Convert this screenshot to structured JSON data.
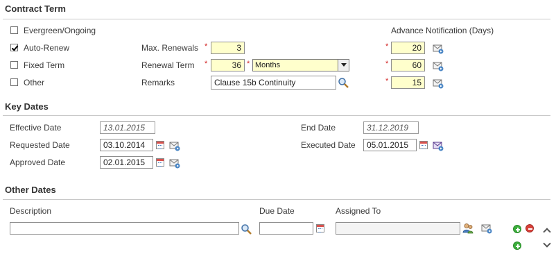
{
  "contract_term": {
    "title": "Contract Term",
    "options": [
      {
        "label": "Evergreen/Ongoing",
        "checked": false
      },
      {
        "label": "Auto-Renew",
        "checked": true
      },
      {
        "label": "Fixed Term",
        "checked": false
      },
      {
        "label": "Other",
        "checked": false
      }
    ],
    "max_renewals": {
      "label": "Max. Renewals",
      "required": "*",
      "value": "3"
    },
    "renewal_term": {
      "label": "Renewal Term",
      "required": "*",
      "value": "36",
      "unit_required": "*",
      "unit": "Months"
    },
    "remarks": {
      "label": "Remarks",
      "value": "Clause 15b Continuity"
    },
    "advance_notification": {
      "label": "Advance Notification (Days)",
      "required": "*",
      "values": [
        "20",
        "60",
        "15"
      ]
    }
  },
  "key_dates": {
    "title": "Key Dates",
    "effective_date": {
      "label": "Effective Date",
      "value": "13.01.2015"
    },
    "end_date": {
      "label": "End Date",
      "value": "31.12.2019"
    },
    "requested_date": {
      "label": "Requested Date",
      "value": "03.10.2014"
    },
    "executed_date": {
      "label": "Executed Date",
      "value": "05.01.2015"
    },
    "approved_date": {
      "label": "Approved Date",
      "value": "02.01.2015"
    }
  },
  "other_dates": {
    "title": "Other Dates",
    "columns": {
      "description": "Description",
      "due_date": "Due Date",
      "assigned_to": "Assigned To"
    },
    "row": {
      "description": "",
      "due_date": "",
      "assigned_to": ""
    }
  },
  "icons": {
    "calendar": "calendar-icon",
    "notify": "notify-envelope-icon",
    "lookup": "lookup-magnifier-icon",
    "user_select": "user-select-icon",
    "add": "add-icon",
    "remove": "remove-icon",
    "move_up": "chevron-up-icon",
    "move_down": "chevron-down-icon"
  },
  "colors": {
    "required": "#d11f1f",
    "input_highlight": "#ffffcc",
    "add": "#3cae3c",
    "remove": "#d9413a"
  }
}
